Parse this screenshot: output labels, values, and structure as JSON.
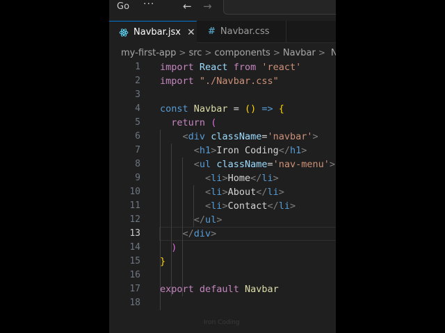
{
  "titlebar": {
    "menu_go": "Go",
    "more": "···",
    "back_icon": "←",
    "forward_icon": "→"
  },
  "tabs": [
    {
      "label": "Navbar.jsx",
      "icon": "react-icon",
      "active": true,
      "close": "✕"
    },
    {
      "label": "Navbar.css",
      "icon": "hash-icon",
      "active": false,
      "glyph": "#"
    }
  ],
  "breadcrumb": {
    "items": [
      "my-first-app",
      "src",
      "components",
      "Navbar",
      "N"
    ],
    "separator": ">"
  },
  "editor": {
    "current_line": 13,
    "lines": [
      {
        "n": "1",
        "tokens": [
          [
            "kw",
            "import"
          ],
          [
            "txt",
            " "
          ],
          [
            "id",
            "React"
          ],
          [
            "txt",
            " "
          ],
          [
            "kw",
            "from"
          ],
          [
            "txt",
            " "
          ],
          [
            "str",
            "'react'"
          ]
        ]
      },
      {
        "n": "2",
        "tokens": [
          [
            "kw",
            "import"
          ],
          [
            "txt",
            " "
          ],
          [
            "str",
            "\"./Navbar.css\""
          ]
        ]
      },
      {
        "n": "3",
        "tokens": []
      },
      {
        "n": "4",
        "tokens": [
          [
            "kw2",
            "const"
          ],
          [
            "txt",
            " "
          ],
          [
            "fn",
            "Navbar"
          ],
          [
            "txt",
            " = "
          ],
          [
            "br",
            "()"
          ],
          [
            "txt",
            " "
          ],
          [
            "kw2",
            "=>"
          ],
          [
            "txt",
            " "
          ],
          [
            "br",
            "{"
          ]
        ]
      },
      {
        "n": "5",
        "tokens": [
          [
            "txt",
            "  "
          ],
          [
            "kw",
            "return"
          ],
          [
            "txt",
            " "
          ],
          [
            "br2",
            "("
          ]
        ]
      },
      {
        "n": "6",
        "tokens": [
          [
            "txt",
            "    "
          ],
          [
            "punc",
            "<"
          ],
          [
            "tag",
            "div"
          ],
          [
            "txt",
            " "
          ],
          [
            "attr",
            "className"
          ],
          [
            "txt",
            "="
          ],
          [
            "str",
            "'navbar'"
          ],
          [
            "punc",
            ">"
          ]
        ]
      },
      {
        "n": "7",
        "tokens": [
          [
            "txt",
            "      "
          ],
          [
            "punc",
            "<"
          ],
          [
            "tag",
            "h1"
          ],
          [
            "punc",
            ">"
          ],
          [
            "txt",
            "Iron Coding"
          ],
          [
            "punc",
            "</"
          ],
          [
            "tag",
            "h1"
          ],
          [
            "punc",
            ">"
          ]
        ]
      },
      {
        "n": "8",
        "tokens": [
          [
            "txt",
            "      "
          ],
          [
            "punc",
            "<"
          ],
          [
            "tag",
            "ul"
          ],
          [
            "txt",
            " "
          ],
          [
            "attr",
            "className"
          ],
          [
            "txt",
            "="
          ],
          [
            "str",
            "'nav-menu'"
          ],
          [
            "punc",
            ">"
          ]
        ]
      },
      {
        "n": "9",
        "tokens": [
          [
            "txt",
            "        "
          ],
          [
            "punc",
            "<"
          ],
          [
            "tag",
            "li"
          ],
          [
            "punc",
            ">"
          ],
          [
            "txt",
            "Home"
          ],
          [
            "punc",
            "</"
          ],
          [
            "tag",
            "li"
          ],
          [
            "punc",
            ">"
          ]
        ]
      },
      {
        "n": "10",
        "tokens": [
          [
            "txt",
            "        "
          ],
          [
            "punc",
            "<"
          ],
          [
            "tag",
            "li"
          ],
          [
            "punc",
            ">"
          ],
          [
            "txt",
            "About"
          ],
          [
            "punc",
            "</"
          ],
          [
            "tag",
            "li"
          ],
          [
            "punc",
            ">"
          ]
        ]
      },
      {
        "n": "11",
        "tokens": [
          [
            "txt",
            "        "
          ],
          [
            "punc",
            "<"
          ],
          [
            "tag",
            "li"
          ],
          [
            "punc",
            ">"
          ],
          [
            "txt",
            "Contact"
          ],
          [
            "punc",
            "</"
          ],
          [
            "tag",
            "li"
          ],
          [
            "punc",
            ">"
          ]
        ]
      },
      {
        "n": "12",
        "tokens": [
          [
            "txt",
            "      "
          ],
          [
            "punc",
            "</"
          ],
          [
            "tag",
            "ul"
          ],
          [
            "punc",
            ">"
          ]
        ]
      },
      {
        "n": "13",
        "tokens": [
          [
            "txt",
            "    "
          ],
          [
            "punc",
            "</"
          ],
          [
            "tag",
            "div"
          ],
          [
            "punc",
            ">"
          ]
        ]
      },
      {
        "n": "14",
        "tokens": [
          [
            "txt",
            "  "
          ],
          [
            "br2",
            ")"
          ]
        ]
      },
      {
        "n": "15",
        "tokens": [
          [
            "br",
            "}"
          ]
        ]
      },
      {
        "n": "16",
        "tokens": []
      },
      {
        "n": "17",
        "tokens": [
          [
            "kw",
            "export"
          ],
          [
            "txt",
            " "
          ],
          [
            "kw",
            "default"
          ],
          [
            "txt",
            " "
          ],
          [
            "fn",
            "Navbar"
          ]
        ]
      },
      {
        "n": "18",
        "tokens": []
      }
    ]
  },
  "watermark": "Iron Coding",
  "colors": {
    "editor_bg": "#1f1f1f",
    "tab_active_border": "#0078d4",
    "keyword": "#c586c0",
    "string": "#ce9178",
    "tag": "#569cd6",
    "function": "#dcdcaa"
  }
}
